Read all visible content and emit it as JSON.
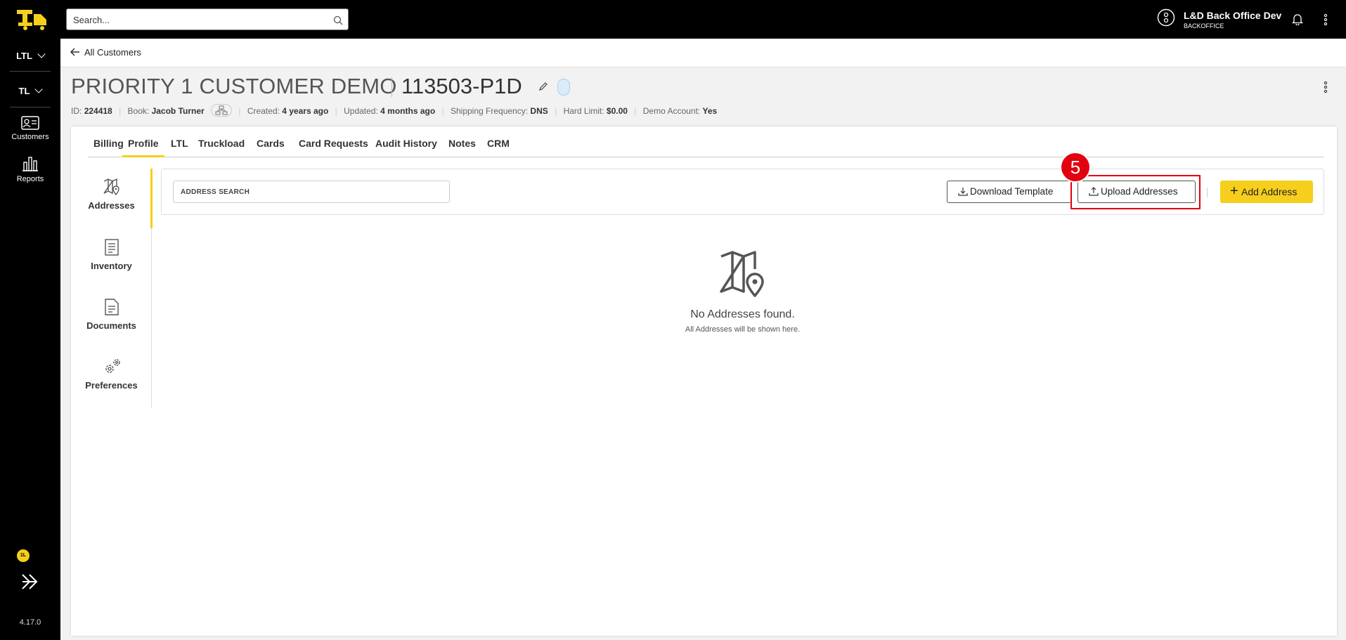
{
  "sidebar": {
    "selectors": [
      {
        "label": "LTL"
      },
      {
        "label": "TL"
      }
    ],
    "items": [
      {
        "label": "Customers",
        "icon": "customers-icon"
      },
      {
        "label": "Reports",
        "icon": "reports-icon"
      }
    ],
    "badge": "1L",
    "version": "4.17.0"
  },
  "topbar": {
    "search_placeholder": "Search...",
    "user_name": "L&D Back Office Dev",
    "user_role": "BACKOFFICE"
  },
  "breadcrumb": {
    "back_label": "All Customers"
  },
  "customer": {
    "name": "PRIORITY 1 CUSTOMER DEMO",
    "code": "113503-P1D",
    "meta": {
      "id_label": "ID:",
      "id_value": "224418",
      "book_label": "Book:",
      "book_value": "Jacob Turner",
      "created_label": "Created:",
      "created_value": "4 years ago",
      "updated_label": "Updated:",
      "updated_value": "4 months ago",
      "freq_label": "Shipping Frequency:",
      "freq_value": "DNS",
      "limit_label": "Hard Limit:",
      "limit_value": "$0.00",
      "demo_label": "Demo Account:",
      "demo_value": "Yes"
    }
  },
  "tabs": [
    {
      "label": "Billing"
    },
    {
      "label": "Profile",
      "active": true
    },
    {
      "label": "LTL"
    },
    {
      "label": "Truckload"
    },
    {
      "label": "Cards"
    },
    {
      "label": "Card Requests"
    },
    {
      "label": "Audit History"
    },
    {
      "label": "Notes"
    },
    {
      "label": "CRM"
    }
  ],
  "subnav": [
    {
      "label": "Addresses",
      "icon": "map-pin-icon",
      "active": true
    },
    {
      "label": "Inventory",
      "icon": "inventory-icon"
    },
    {
      "label": "Documents",
      "icon": "document-icon"
    },
    {
      "label": "Preferences",
      "icon": "gears-icon"
    }
  ],
  "toolbar": {
    "search_placeholder": "ADDRESS SEARCH",
    "download_label": "Download Template",
    "upload_label": "Upload Addresses",
    "add_label": "Add Address",
    "step_number": "5"
  },
  "empty_state": {
    "title": "No Addresses found.",
    "subtitle": "All Addresses will be shown here."
  },
  "colors": {
    "accent": "#f5cf1c",
    "highlight": "#e3000f",
    "sidebar_bg": "#000000"
  }
}
